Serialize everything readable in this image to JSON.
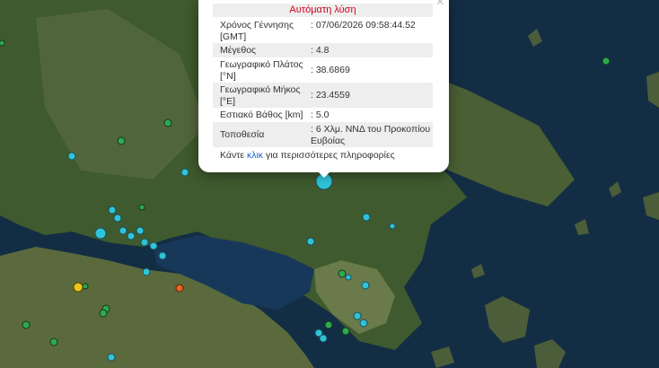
{
  "map": {
    "marker_colors": {
      "cyan": "#2ec4d8",
      "green": "#2fa84f",
      "yellow": "#f0c419",
      "orange": "#e8631c"
    }
  },
  "popup": {
    "title": "Αυτόματη λύση",
    "close_label": "×",
    "rows": [
      {
        "label": "Χρόνος Γέννησης [GMT]",
        "value": ": 07/06/2026 09:58:44.52"
      },
      {
        "label": "Μέγεθος",
        "value": ": 4.8"
      },
      {
        "label": "Γεωγραφικό Πλάτος [°N]",
        "value": ": 38.6869"
      },
      {
        "label": "Γεωγραφικό Μήκος [°E]",
        "value": ": 23.4559"
      },
      {
        "label": "Εστιακό Βάθος [km]",
        "value": ": 5.0"
      },
      {
        "label": "Τοποθεσία",
        "value": ": 6 Χλμ. ΝΝΔ του Προκοπίου Ευβοίας"
      }
    ],
    "footer_prefix": "Κάντε",
    "footer_link": "κλικ",
    "footer_suffix": "για περισσότερες πληροφορίες"
  }
}
